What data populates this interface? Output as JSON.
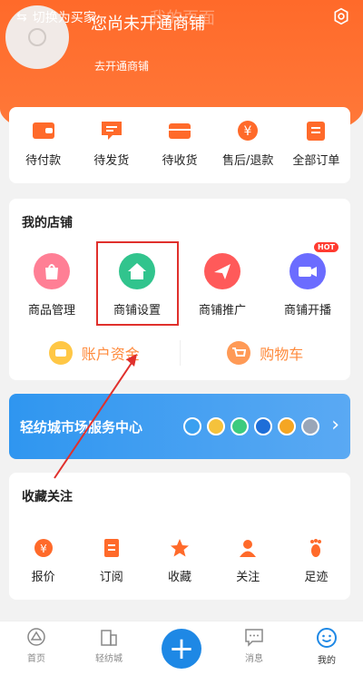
{
  "header": {
    "switch_label": "切换为买家",
    "ghost_title": "我的页面",
    "shop_status": "您尚未开通商铺",
    "open_link": "去开通商铺"
  },
  "orders": [
    {
      "label": "待付款",
      "icon": "wallet-icon"
    },
    {
      "label": "待发货",
      "icon": "message-icon"
    },
    {
      "label": "待收货",
      "icon": "box-icon"
    },
    {
      "label": "售后/退款",
      "icon": "yen-icon"
    },
    {
      "label": "全部订单",
      "icon": "list-icon"
    }
  ],
  "shop": {
    "title": "我的店铺",
    "items": [
      {
        "label": "商品管理",
        "icon": "bag-icon",
        "color": "#ff6f8a"
      },
      {
        "label": "商铺设置",
        "icon": "house-icon",
        "color": "#31c48d"
      },
      {
        "label": "商铺推广",
        "icon": "plane-icon",
        "color": "#ff5a5a"
      },
      {
        "label": "商铺开播",
        "icon": "camera-icon",
        "color": "#6b6cff"
      }
    ],
    "hot_badge": "HOT",
    "account_label": "账户资金",
    "cart_label": "购物车"
  },
  "service": {
    "title": "轻纺城市场服务中心"
  },
  "favorites": {
    "title": "收藏关注",
    "items": [
      {
        "label": "报价",
        "icon": "yen-circle-icon"
      },
      {
        "label": "订阅",
        "icon": "doc-icon"
      },
      {
        "label": "收藏",
        "icon": "star-icon"
      },
      {
        "label": "关注",
        "icon": "person-icon"
      },
      {
        "label": "足迹",
        "icon": "footprint-icon"
      }
    ]
  },
  "tabbar": {
    "items": [
      {
        "label": "首页",
        "icon": "home-icon"
      },
      {
        "label": "轻纺城",
        "icon": "building-icon"
      },
      {
        "label": "",
        "icon": "plus-icon"
      },
      {
        "label": "消息",
        "icon": "chat-icon"
      },
      {
        "label": "我的",
        "icon": "smile-icon"
      }
    ]
  },
  "colors": {
    "brand_orange": "#ff6a2a",
    "service_blue": "#2f96f0",
    "highlight_red": "#e0302c"
  }
}
